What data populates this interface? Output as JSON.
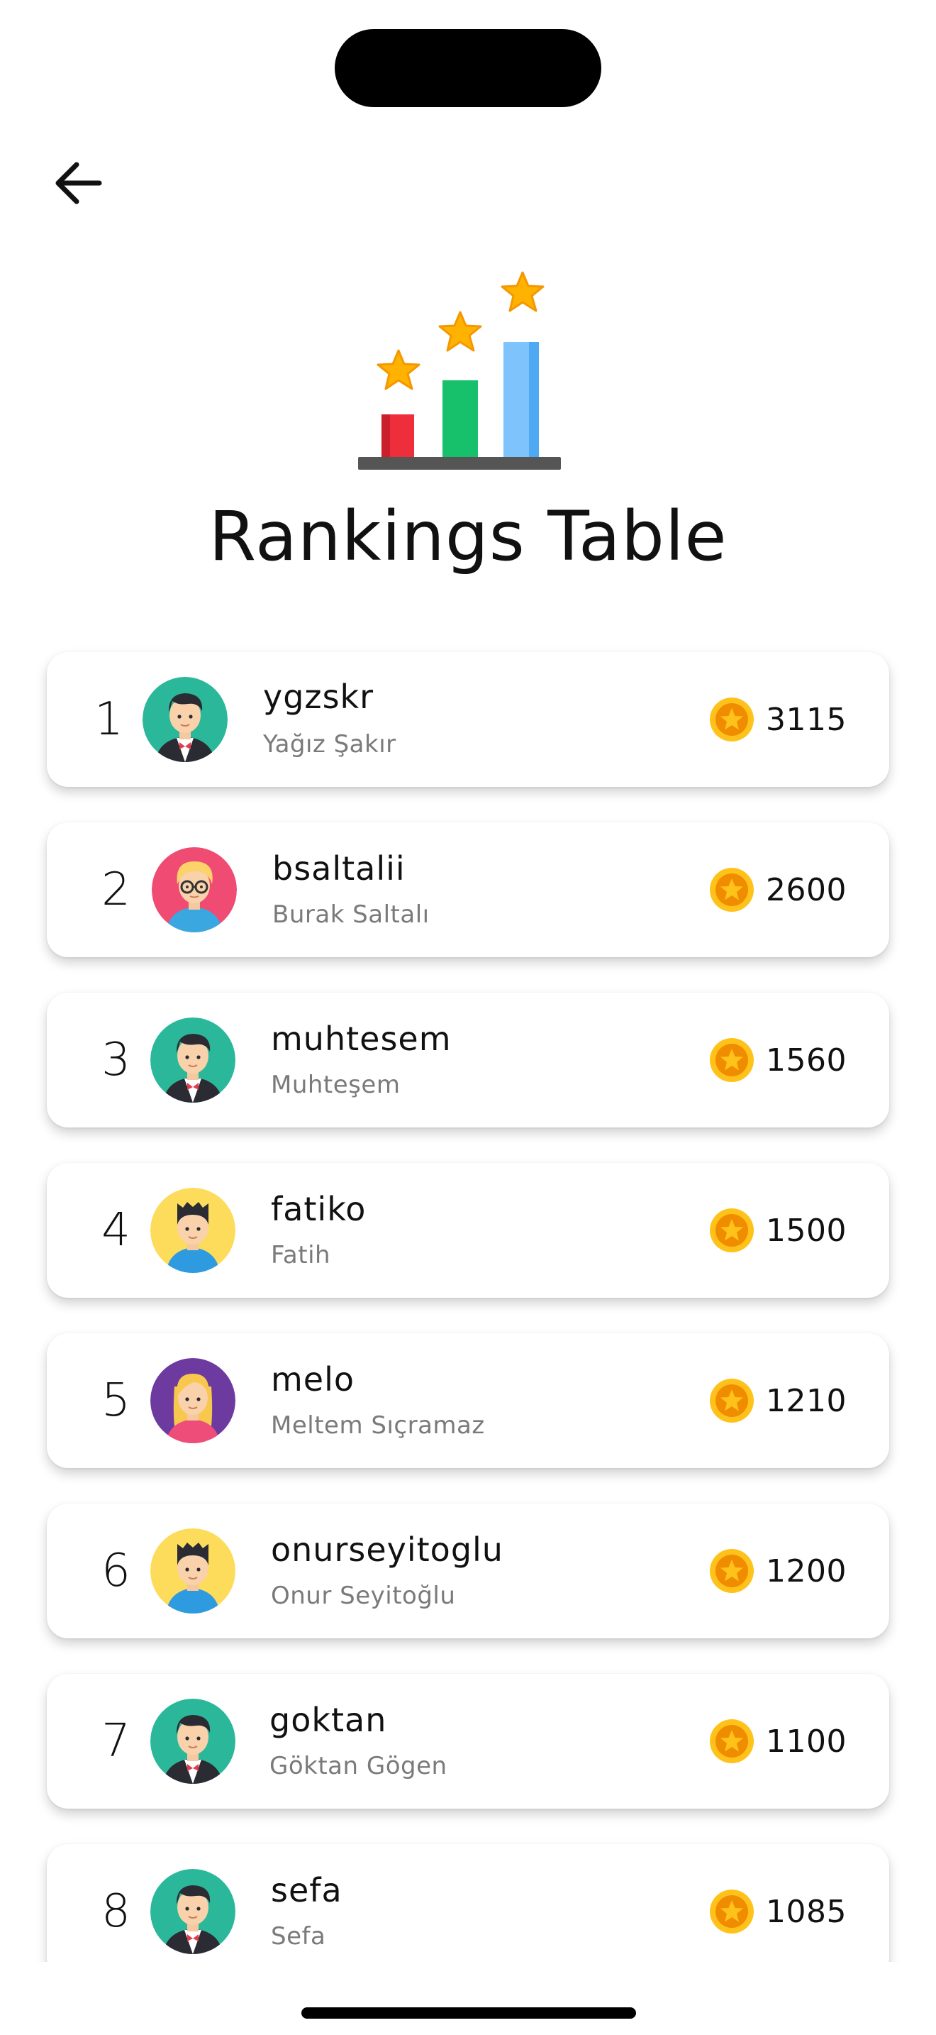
{
  "header": {
    "title": "Rankings Table",
    "back_icon": "arrow-left-icon",
    "hero_icon": "ranking-bar-chart-stars-icon"
  },
  "colors": {
    "coin_outer": "#F5A623",
    "coin_inner": "#F08C00",
    "star": "#FFB300",
    "bar_red": "#EE2E3A",
    "bar_green": "#17C16B",
    "bar_blue": "#7EC3FB",
    "avatar_green": "#2BB89A",
    "avatar_pink": "#EF4B73",
    "avatar_yellow": "#FDDC5C",
    "avatar_purple": "#6D3BA0"
  },
  "rankings": [
    {
      "rank": "1",
      "username": "ygzskr",
      "name": "Yağız Şakır",
      "score": "3115",
      "avatar": "man-tuxedo-avatar-green"
    },
    {
      "rank": "2",
      "username": "bsaltalii",
      "name": "Burak Saltalı",
      "score": "2600",
      "avatar": "blond-glasses-avatar-pink"
    },
    {
      "rank": "3",
      "username": "muhtesem",
      "name": "Muhteşem",
      "score": "1560",
      "avatar": "man-tuxedo-avatar-green"
    },
    {
      "rank": "4",
      "username": "fatiko",
      "name": "Fatih",
      "score": "1500",
      "avatar": "boy-avatar-yellow"
    },
    {
      "rank": "5",
      "username": "melo",
      "name": "Meltem Sıçramaz",
      "score": "1210",
      "avatar": "woman-blonde-avatar-purple"
    },
    {
      "rank": "6",
      "username": "onurseyitoglu",
      "name": "Onur Seyitoğlu",
      "score": "1200",
      "avatar": "boy-avatar-yellow"
    },
    {
      "rank": "7",
      "username": "goktan",
      "name": "Göktan Gögen",
      "score": "1100",
      "avatar": "man-tuxedo-avatar-green"
    },
    {
      "rank": "8",
      "username": "sefa",
      "name": "Sefa",
      "score": "1085",
      "avatar": "man-tuxedo-avatar-green"
    }
  ]
}
